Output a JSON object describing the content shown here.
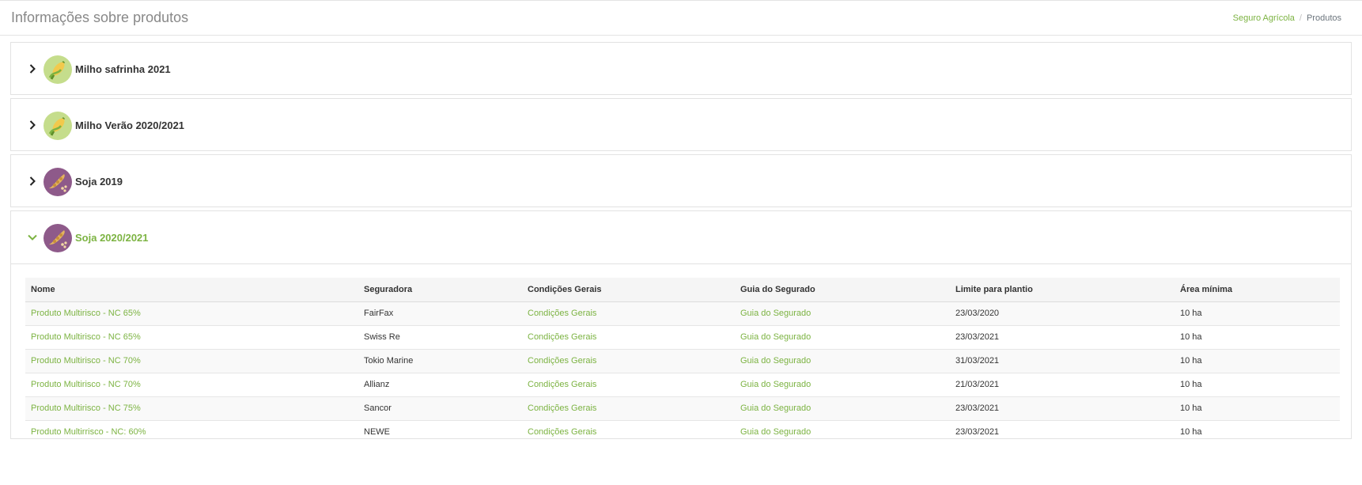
{
  "header": {
    "title": "Informações sobre produtos",
    "breadcrumb": {
      "link": "Seguro Agrícola",
      "separator": "/",
      "current": "Produtos"
    }
  },
  "colors": {
    "accent": "#7cb342",
    "corn_bg": "#c5dd8c",
    "soy_bg": "#8e5a8a"
  },
  "panels": [
    {
      "title": "Milho safrinha 2021",
      "icon": "corn-icon",
      "expanded": false
    },
    {
      "title": "Milho Verão 2020/2021",
      "icon": "corn-icon",
      "expanded": false
    },
    {
      "title": "Soja 2019",
      "icon": "soybean-icon",
      "expanded": false
    },
    {
      "title": "Soja 2020/2021",
      "icon": "soybean-icon",
      "expanded": true
    }
  ],
  "products_table": {
    "columns": [
      "Nome",
      "Seguradora",
      "Condições Gerais",
      "Guia do Segurado",
      "Limite para plantio",
      "Área mínima"
    ],
    "rows": [
      {
        "name": "Produto Multirisco - NC 65%",
        "insurer": "FairFax",
        "conditions": "Condições Gerais",
        "guide": "Guia do Segurado",
        "deadline": "23/03/2020",
        "min_area": "10 ha"
      },
      {
        "name": "Produto Multirisco - NC 65%",
        "insurer": "Swiss Re",
        "conditions": "Condições Gerais",
        "guide": "Guia do Segurado",
        "deadline": "23/03/2021",
        "min_area": "10 ha"
      },
      {
        "name": "Produto Multirisco - NC 70%",
        "insurer": "Tokio Marine",
        "conditions": "Condições Gerais",
        "guide": "Guia do Segurado",
        "deadline": "31/03/2021",
        "min_area": "10 ha"
      },
      {
        "name": "Produto Multirisco - NC 70%",
        "insurer": "Allianz",
        "conditions": "Condições Gerais",
        "guide": "Guia do Segurado",
        "deadline": "21/03/2021",
        "min_area": "10 ha"
      },
      {
        "name": "Produto Multirisco - NC 75%",
        "insurer": "Sancor",
        "conditions": "Condições Gerais",
        "guide": "Guia do Segurado",
        "deadline": "23/03/2021",
        "min_area": "10 ha"
      },
      {
        "name": "Produto Multirrisco - NC: 60%",
        "insurer": "NEWE",
        "conditions": "Condições Gerais",
        "guide": "Guia do Segurado",
        "deadline": "23/03/2021",
        "min_area": "10 ha"
      }
    ]
  }
}
